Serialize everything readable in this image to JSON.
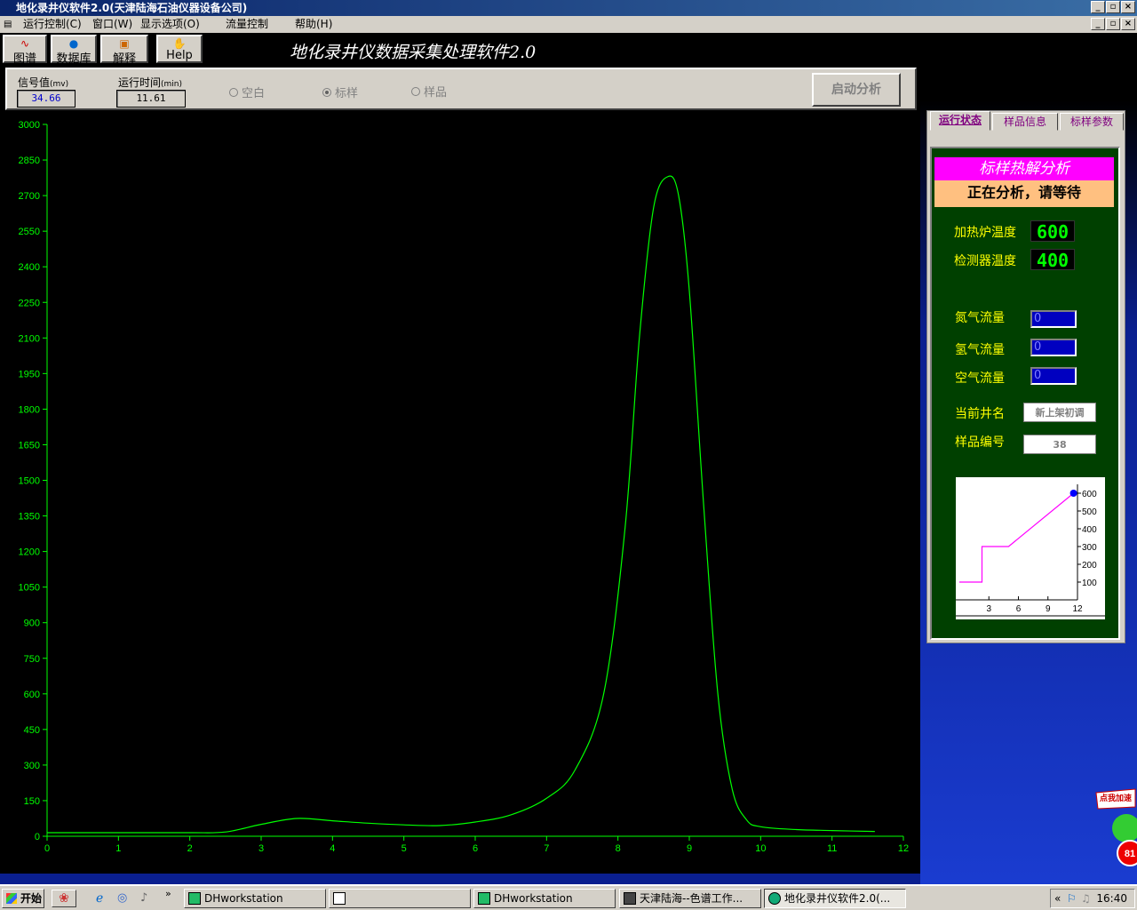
{
  "window": {
    "title": "地化录井仪软件2.0(天津陆海石油仪器设备公司)",
    "controls": [
      "_",
      "▫",
      "×"
    ]
  },
  "menu": {
    "items": [
      "运行控制(C)",
      "窗口(W)",
      "显示选项(O)",
      "流量控制",
      "帮助(H)"
    ],
    "controls": [
      "_",
      "▫",
      "×"
    ]
  },
  "toolbar": {
    "buttons": [
      "图谱",
      "数据库",
      "解释",
      "Help"
    ],
    "app_title": "地化录井仪数据采集处理软件2.0"
  },
  "controls": {
    "signal_label": "信号值",
    "signal_unit": "(mv)",
    "signal_value": "34.66",
    "time_label": "运行时间",
    "time_unit": "(min)",
    "time_value": "11.61",
    "radio_blank": "空白",
    "radio_standard": "标样",
    "radio_sample": "样品",
    "selected_radio": "标样",
    "start_button": "启动分析"
  },
  "side_panel": {
    "tabs": [
      "运行状态",
      "样品信息",
      "标样参数"
    ],
    "active_tab": "运行状态",
    "mode_banner": "标样热解分析",
    "status_banner": "正在分析，请等待",
    "furnace_temp_label": "加热炉温度",
    "furnace_temp": "600",
    "detector_temp_label": "检测器温度",
    "detector_temp": "400",
    "nitrogen_label": "氮气流量",
    "nitrogen_value": "0",
    "hydrogen_label": "氢气流量",
    "hydrogen_value": "0",
    "air_label": "空气流量",
    "air_value": "0",
    "well_label": "当前井名",
    "well_value": "新上架初调",
    "sample_no_label": "样品编号",
    "sample_no_value": "38"
  },
  "chart_data": [
    {
      "type": "line",
      "x_ticks": [
        "0",
        "1",
        "2",
        "3",
        "4",
        "5",
        "6",
        "7",
        "8",
        "9",
        "10",
        "11",
        "12"
      ],
      "y_ticks": [
        "0",
        "150",
        "300",
        "450",
        "600",
        "750",
        "900",
        "1050",
        "1200",
        "1350",
        "1500",
        "1650",
        "1800",
        "1950",
        "2100",
        "2250",
        "2400",
        "2550",
        "2700",
        "2850",
        "3000"
      ],
      "xlim": [
        0,
        12
      ],
      "ylim": [
        0,
        3000
      ],
      "color": "#00ff00",
      "points": [
        [
          0,
          15
        ],
        [
          1,
          15
        ],
        [
          2,
          15
        ],
        [
          2.5,
          18
        ],
        [
          3,
          50
        ],
        [
          3.5,
          75
        ],
        [
          4,
          65
        ],
        [
          4.5,
          55
        ],
        [
          5,
          48
        ],
        [
          5.5,
          45
        ],
        [
          6,
          60
        ],
        [
          6.5,
          90
        ],
        [
          7,
          160
        ],
        [
          7.4,
          280
        ],
        [
          7.8,
          600
        ],
        [
          8.1,
          1300
        ],
        [
          8.3,
          2100
        ],
        [
          8.5,
          2650
        ],
        [
          8.7,
          2780
        ],
        [
          8.85,
          2700
        ],
        [
          9.0,
          2300
        ],
        [
          9.2,
          1400
        ],
        [
          9.4,
          600
        ],
        [
          9.6,
          200
        ],
        [
          9.8,
          70
        ],
        [
          10,
          40
        ],
        [
          10.5,
          28
        ],
        [
          11,
          24
        ],
        [
          11.6,
          20
        ]
      ]
    },
    {
      "type": "line",
      "x_ticks": [
        "3",
        "6",
        "9",
        "12"
      ],
      "y_ticks": [
        "100",
        "200",
        "300",
        "400",
        "500",
        "600"
      ],
      "xlim": [
        0,
        12
      ],
      "ylim": [
        0,
        650
      ],
      "color": "#ff00ff",
      "points": [
        [
          0,
          100
        ],
        [
          2.3,
          100
        ],
        [
          2.3,
          300
        ],
        [
          5,
          300
        ],
        [
          11.6,
          600
        ]
      ],
      "marker": [
        11.6,
        600
      ]
    }
  ],
  "taskbar": {
    "start": "开始",
    "tasks": [
      "DHworkstation",
      "",
      "DHworkstation",
      "天津陆海--色谱工作...",
      "地化录井仪软件2.0(..."
    ],
    "active_task": 4,
    "clock": "16:40",
    "tray_expand": "«"
  },
  "ad": {
    "label": "点我加速",
    "value": "81"
  }
}
